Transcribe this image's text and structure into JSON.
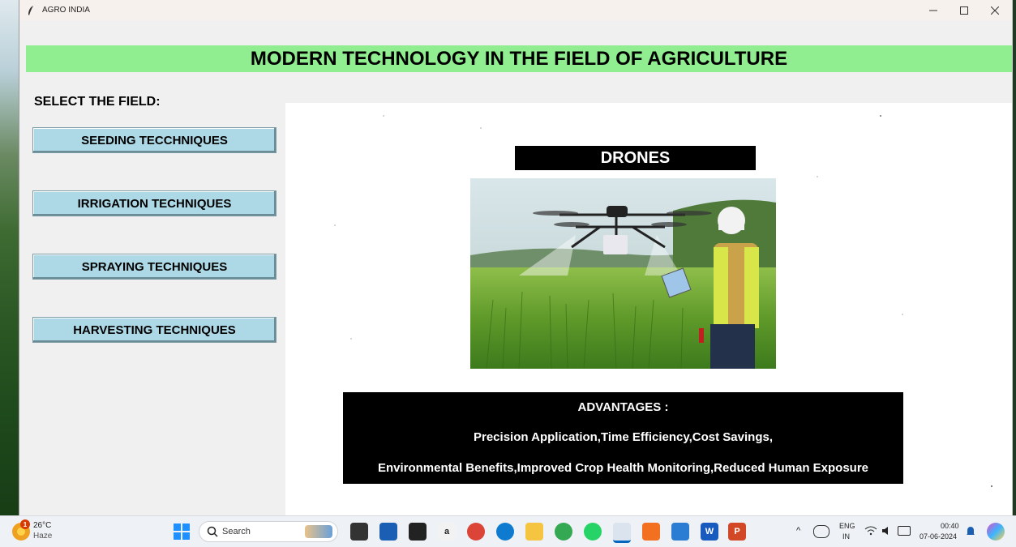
{
  "window": {
    "title": "AGRO INDIA"
  },
  "banner": {
    "title": "MODERN TECHNOLOGY IN THE FIELD OF AGRICULTURE",
    "color": "#90ee90"
  },
  "sidebar": {
    "label": "SELECT THE FIELD:",
    "buttons": [
      {
        "label": "SEEDING TECCHNIQUES"
      },
      {
        "label": "IRRIGATION TECHNIQUES"
      },
      {
        "label": "SPRAYING TECHNIQUES"
      },
      {
        "label": "HARVESTING TECHNIQUES"
      }
    ],
    "button_color": "#add8e6"
  },
  "content": {
    "heading": "DRONES",
    "image_icon": "drone-photo",
    "advantages_title": "ADVANTAGES :",
    "advantages_line1": "Precision Application,Time Efficiency,Cost Savings,",
    "advantages_line2": "Environmental Benefits,Improved Crop Health Monitoring,Reduced Human Exposure"
  },
  "taskbar": {
    "weather_badge": "1",
    "weather_temp": "26°C",
    "weather_desc": "Haze",
    "search_label": "Search",
    "language": "ENG",
    "region": "IN",
    "time": "00:40",
    "date": "07-06-2024"
  }
}
